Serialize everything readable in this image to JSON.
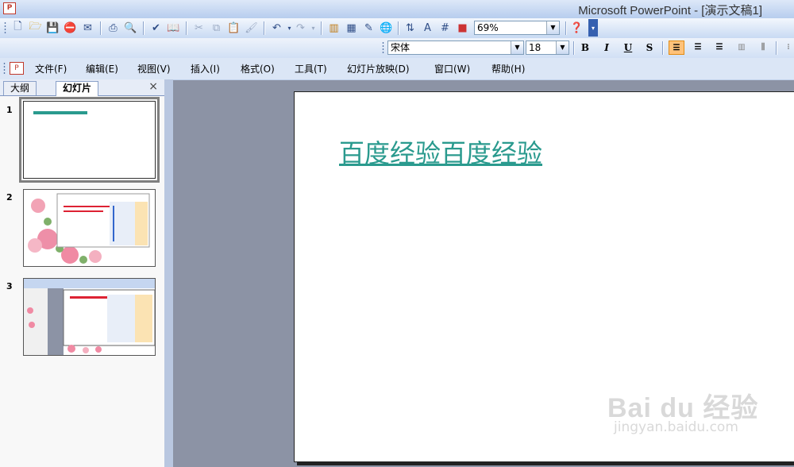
{
  "window": {
    "title": "Microsoft PowerPoint - [演示文稿1]",
    "app_icon": "powerpoint-app-icon"
  },
  "toolbar": {
    "zoom": "69%",
    "font_name": "宋体",
    "font_size": "18",
    "bold": "B",
    "italic": "I",
    "underline": "U",
    "shadow": "S"
  },
  "menu": {
    "items": [
      "文件(F)",
      "编辑(E)",
      "视图(V)",
      "插入(I)",
      "格式(O)",
      "工具(T)",
      "幻灯片放映(D)",
      "窗口(W)",
      "帮助(H)"
    ]
  },
  "pane": {
    "tabs": [
      "大纲",
      "幻灯片"
    ],
    "close": "×",
    "slides": [
      {
        "number": "1",
        "selected": true
      },
      {
        "number": "2",
        "selected": false
      },
      {
        "number": "3",
        "selected": false
      }
    ]
  },
  "slide": {
    "title": "百度经验百度经验",
    "title_color": "#2a9a8e"
  },
  "watermark": {
    "logo": "Bai du 经验",
    "url": "jingyan.baidu.com"
  }
}
